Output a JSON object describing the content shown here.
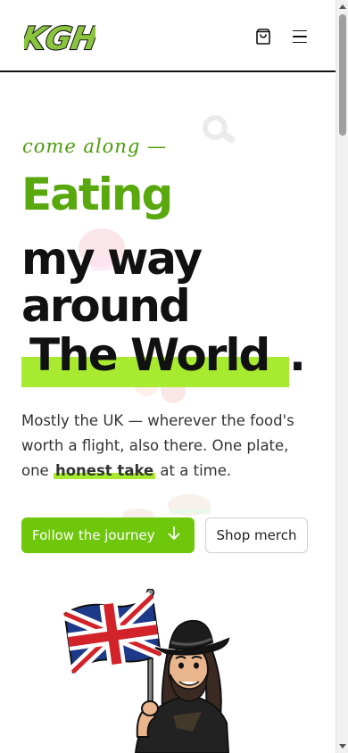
{
  "header": {
    "logo_text": "KGH",
    "cart_icon": "shopping-bag-icon",
    "menu_icon": "hamburger-menu-icon"
  },
  "hero": {
    "kicker": "come along —",
    "line1": "Eating",
    "line2": "my way",
    "line3": "around",
    "line4": "The World",
    "line4_end": ".",
    "desc_part1": "Mostly the UK — wherever the food's worth a flight, also there. One plate, one ",
    "desc_highlight": "honest take",
    "desc_part2": " at a time.",
    "primary_button": "Follow the journey",
    "secondary_button": "Shop merch"
  },
  "colors": {
    "accent_green": "#6ec70b",
    "headline_green": "#58a80e",
    "highlight_lime": "#a7ea2f"
  }
}
